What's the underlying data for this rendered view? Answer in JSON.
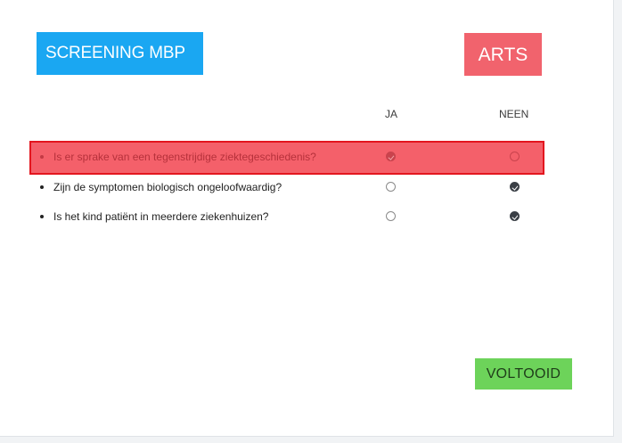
{
  "header": {
    "title_button": "SCREENING MBP",
    "role_button": "ARTS"
  },
  "columns": {
    "yes": "JA",
    "no": "NEEN"
  },
  "questions": [
    {
      "text": "Is er sprake van een tegenstrijdige ziektegeschiedenis?",
      "answer": "JA",
      "highlighted": true
    },
    {
      "text": "Zijn de symptomen biologisch ongeloofwaardig?",
      "answer": "NEEN",
      "highlighted": false
    },
    {
      "text": "Is het kind patiënt in meerdere ziekenhuizen?",
      "answer": "NEEN",
      "highlighted": false
    }
  ],
  "footer": {
    "done_button": "VOLTOOID"
  },
  "colors": {
    "title_button": "#1aa7f2",
    "role_button": "#f1636d",
    "highlight": "#f4606a",
    "highlight_border": "#e3161f",
    "done_button": "#6dd35a"
  },
  "icons": {
    "radio_checked": "radio-checked-icon",
    "radio_unchecked": "radio-unchecked-icon",
    "bullet": "bullet-icon"
  }
}
